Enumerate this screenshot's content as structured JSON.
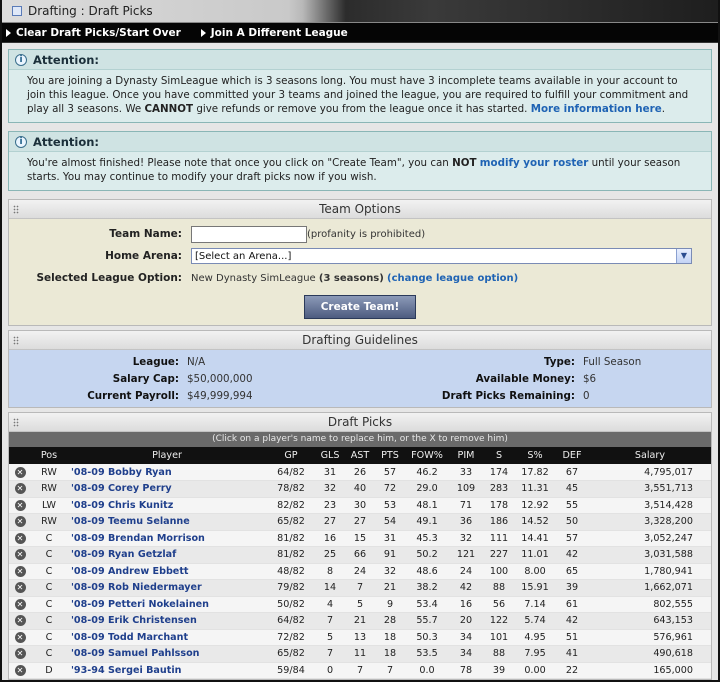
{
  "window": {
    "title": "Drafting : Draft Picks"
  },
  "actions": [
    {
      "label": "Clear Draft Picks/Start Over"
    },
    {
      "label": "Join A Different League"
    }
  ],
  "attention1": {
    "title": "Attention:",
    "text1": "You are joining a Dynasty SimLeague which is 3 seasons long. You must have 3 incomplete teams available in your account to join this league. Once you have committed your 3 teams and joined the league, you are required to fulfill your commitment and play all 3 seasons. We ",
    "bold": "CANNOT",
    "text2": " give refunds or remove you from the league once it has started. ",
    "link": "More information here",
    "text3": "."
  },
  "attention2": {
    "title": "Attention:",
    "text1": "You're almost finished! Please note that once you click on \"Create Team\", you can ",
    "bold": "NOT",
    "link": "modify your roster",
    "text2": " until your season starts. You may continue to modify your draft picks now if you wish."
  },
  "team_options": {
    "title": "Team Options",
    "team_name_label": "Team Name:",
    "team_name_value": "",
    "profanity_note": "(profanity is prohibited)",
    "home_arena_label": "Home Arena:",
    "home_arena_value": "[Select an Arena...]",
    "league_option_label": "Selected League Option:",
    "league_option_text": "New Dynasty SimLeague ",
    "league_option_bold": "(3 seasons)",
    "league_option_link": "change league option",
    "create_button": "Create Team!"
  },
  "guidelines": {
    "title": "Drafting Guidelines",
    "league_label": "League:",
    "league_value": "N/A",
    "type_label": "Type:",
    "type_value": "Full Season",
    "cap_label": "Salary Cap:",
    "cap_value": "$50,000,000",
    "money_label": "Available Money:",
    "money_value": "$6",
    "payroll_label": "Current Payroll:",
    "payroll_value": "$49,999,994",
    "picks_label": "Draft Picks Remaining:",
    "picks_value": "0"
  },
  "draft_picks": {
    "title": "Draft Picks",
    "subtitle": "(Click on a player's name to replace him, or the X to remove him)",
    "columns": [
      "Pos",
      "Player",
      "GP",
      "GLS",
      "AST",
      "PTS",
      "FOW%",
      "PIM",
      "S",
      "S%",
      "DEF",
      "Salary"
    ],
    "rows": [
      [
        "RW",
        "'08-09 Bobby Ryan",
        "64/82",
        "31",
        "26",
        "57",
        "46.2",
        "33",
        "174",
        "17.82",
        "67",
        "4,795,017"
      ],
      [
        "RW",
        "'08-09 Corey Perry",
        "78/82",
        "32",
        "40",
        "72",
        "29.0",
        "109",
        "283",
        "11.31",
        "45",
        "3,551,713"
      ],
      [
        "LW",
        "'08-09 Chris Kunitz",
        "82/82",
        "23",
        "30",
        "53",
        "48.1",
        "71",
        "178",
        "12.92",
        "55",
        "3,514,428"
      ],
      [
        "RW",
        "'08-09 Teemu Selanne",
        "65/82",
        "27",
        "27",
        "54",
        "49.1",
        "36",
        "186",
        "14.52",
        "50",
        "3,328,200"
      ],
      [
        "C",
        "'08-09 Brendan Morrison",
        "81/82",
        "16",
        "15",
        "31",
        "45.3",
        "32",
        "111",
        "14.41",
        "57",
        "3,052,247"
      ],
      [
        "C",
        "'08-09 Ryan Getzlaf",
        "81/82",
        "25",
        "66",
        "91",
        "50.2",
        "121",
        "227",
        "11.01",
        "42",
        "3,031,588"
      ],
      [
        "C",
        "'08-09 Andrew Ebbett",
        "48/82",
        "8",
        "24",
        "32",
        "48.6",
        "24",
        "100",
        "8.00",
        "65",
        "1,780,941"
      ],
      [
        "C",
        "'08-09 Rob Niedermayer",
        "79/82",
        "14",
        "7",
        "21",
        "38.2",
        "42",
        "88",
        "15.91",
        "39",
        "1,662,071"
      ],
      [
        "C",
        "'08-09 Petteri Nokelainen",
        "50/82",
        "4",
        "5",
        "9",
        "53.4",
        "16",
        "56",
        "7.14",
        "61",
        "802,555"
      ],
      [
        "C",
        "'08-09 Erik Christensen",
        "64/82",
        "7",
        "21",
        "28",
        "55.7",
        "20",
        "122",
        "5.74",
        "42",
        "643,153"
      ],
      [
        "C",
        "'08-09 Todd Marchant",
        "72/82",
        "5",
        "13",
        "18",
        "50.3",
        "34",
        "101",
        "4.95",
        "51",
        "576,961"
      ],
      [
        "C",
        "'08-09 Samuel Pahlsson",
        "65/82",
        "7",
        "11",
        "18",
        "53.5",
        "34",
        "88",
        "7.95",
        "41",
        "490,618"
      ],
      [
        "D",
        "'93-94 Sergei Bautin",
        "59/84",
        "0",
        "7",
        "7",
        "0.0",
        "78",
        "39",
        "0.00",
        "22",
        "165,000"
      ]
    ]
  }
}
